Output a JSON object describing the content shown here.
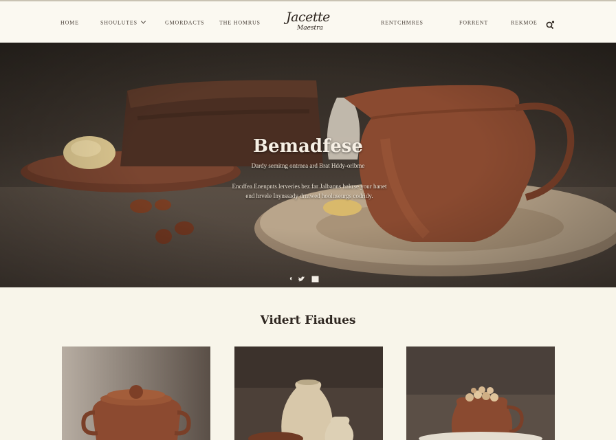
{
  "nav": {
    "home": "HOME",
    "item2": "SHOULUTES",
    "item3": "GMORDACTS",
    "item4": "THE HOMRUS",
    "logo_line1": "Jacette",
    "logo_line2": "Maestra",
    "item5": "RENTCHMRES",
    "item6": "FORRENT",
    "item7": "REKMOE",
    "search_icon": "search-icon"
  },
  "hero": {
    "title": "Bemadfese",
    "subtitle": "Dardy semitng ontrnea ard Brat Hddy-orlbme",
    "body_line1": "Encdfea Enenpnts lerveries bez far Jalbanns hakrse your hanet",
    "body_line2": "end hrvele Inynssady drntwed hooluseurgs codridy.",
    "social_icons": [
      "circle-icon",
      "twitter-icon",
      "email-icon"
    ]
  },
  "featured": {
    "title": "Vidert Fiadues",
    "cards": [
      "card-sugar-pot",
      "card-vases",
      "card-nut-pitcher"
    ]
  },
  "colors": {
    "background": "#f8f5ea",
    "terracotta": "#8a4a30",
    "hero_dark": "#3c342d"
  }
}
